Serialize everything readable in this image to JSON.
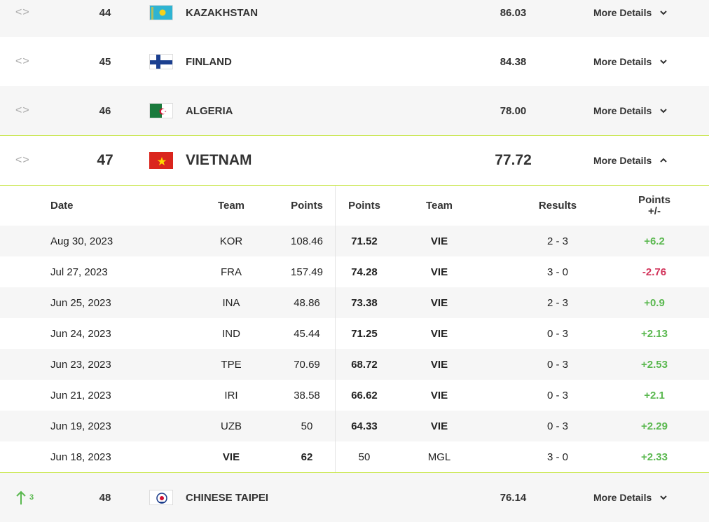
{
  "rankings": [
    {
      "trend": "<>",
      "rank": "44",
      "country": "KAZAKHSTAN",
      "points": "86.03",
      "details": "More Details",
      "flag": "kazakhstan-flag"
    },
    {
      "trend": "<>",
      "rank": "45",
      "country": "FINLAND",
      "points": "84.38",
      "details": "More Details",
      "flag": "finland-flag"
    },
    {
      "trend": "<>",
      "rank": "46",
      "country": "ALGERIA",
      "points": "78.00",
      "details": "More Details",
      "flag": "algeria-flag"
    },
    {
      "trend": "<>",
      "rank": "47",
      "country": "VIETNAM",
      "points": "77.72",
      "details": "More Details",
      "flag": "vietnam-flag"
    },
    {
      "trend": "3",
      "rank": "48",
      "country": "CHINESE TAIPEI",
      "points": "76.14",
      "details": "More Details",
      "flag": "chinese-taipei-flag"
    }
  ],
  "matches_header": {
    "date": "Date",
    "team1": "Team",
    "points1": "Points",
    "points2": "Points",
    "team2": "Team",
    "results": "Results",
    "diff_line1": "Points",
    "diff_line2": "+/-"
  },
  "matches": [
    {
      "date": "Aug 30, 2023",
      "team1": "KOR",
      "points1": "108.46",
      "points2": "71.52",
      "team2": "VIE",
      "result": "2 - 3",
      "diff": "+6.2"
    },
    {
      "date": "Jul 27, 2023",
      "team1": "FRA",
      "points1": "157.49",
      "points2": "74.28",
      "team2": "VIE",
      "result": "3 - 0",
      "diff": "-2.76"
    },
    {
      "date": "Jun 25, 2023",
      "team1": "INA",
      "points1": "48.86",
      "points2": "73.38",
      "team2": "VIE",
      "result": "2 - 3",
      "diff": "+0.9"
    },
    {
      "date": "Jun 24, 2023",
      "team1": "IND",
      "points1": "45.44",
      "points2": "71.25",
      "team2": "VIE",
      "result": "0 - 3",
      "diff": "+2.13"
    },
    {
      "date": "Jun 23, 2023",
      "team1": "TPE",
      "points1": "70.69",
      "points2": "68.72",
      "team2": "VIE",
      "result": "0 - 3",
      "diff": "+2.53"
    },
    {
      "date": "Jun 21, 2023",
      "team1": "IRI",
      "points1": "38.58",
      "points2": "66.62",
      "team2": "VIE",
      "result": "0 - 3",
      "diff": "+2.1"
    },
    {
      "date": "Jun 19, 2023",
      "team1": "UZB",
      "points1": "50",
      "points2": "64.33",
      "team2": "VIE",
      "result": "0 - 3",
      "diff": "+2.29"
    },
    {
      "date": "Jun 18, 2023",
      "team1": "VIE",
      "points1": "62",
      "points2": "50",
      "team2": "MGL",
      "result": "3 - 0",
      "diff": "+2.33"
    }
  ],
  "colors": {
    "accent_line": "#c8e64a",
    "positive": "#5ab84f",
    "negative": "#d2335a"
  }
}
